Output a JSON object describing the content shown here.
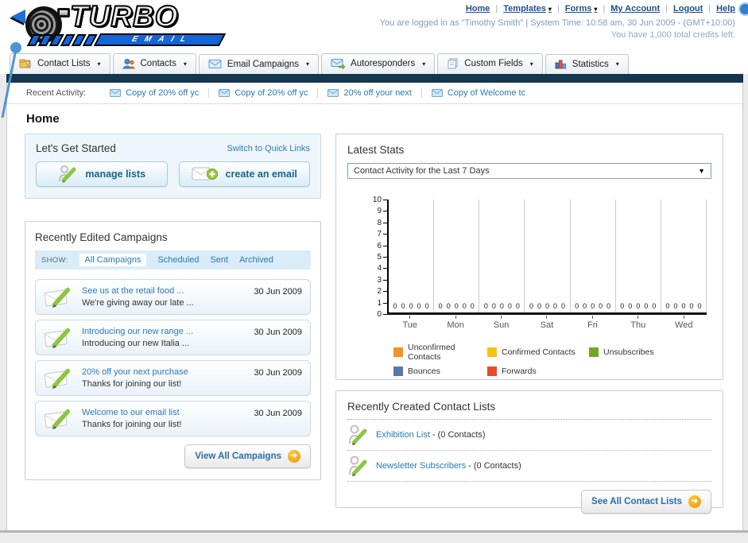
{
  "glyphs": {
    "caret_down": "▼",
    "caret_small": "▼",
    "arrow_right": "➜",
    "separator": "|"
  },
  "colors": {
    "brand_blue": "#1466d8",
    "navy_bar": "#16364e",
    "link_blue": "#2a7ab5",
    "accent_orange": "#ef920b"
  },
  "header": {
    "logo_line1": "TURBO",
    "logo_line2": "EMAIL",
    "nav": {
      "home": "Home",
      "templates": "Templates",
      "forms": "Forms",
      "my_account": "My Account",
      "logout": "Logout",
      "help": "Help"
    },
    "user_line1": "You are logged in as \"Timothy Smith\" | System Time: 10:58 am, 30 Jun 2009 - (GMT+10:00)",
    "user_line2": "You have 1,000 total credits left."
  },
  "tabs": [
    {
      "label": "Contact Lists",
      "icon": "contact-lists-folder-icon"
    },
    {
      "label": "Contacts",
      "icon": "contacts-people-icon"
    },
    {
      "label": "Email Campaigns",
      "icon": "email-envelope-icon"
    },
    {
      "label": "Autoresponders",
      "icon": "autoresponder-envelope-arrow-icon"
    },
    {
      "label": "Custom Fields",
      "icon": "custom-fields-pages-icon"
    },
    {
      "label": "Statistics",
      "icon": "statistics-bars-icon"
    }
  ],
  "recent_activity": {
    "label": "Recent Activity:",
    "items": [
      "Copy of 20% off yc",
      "Copy of 20% off yc",
      "20% off your next",
      "Copy of Welcome tc"
    ]
  },
  "page_title": "Home",
  "get_started": {
    "title": "Let's Get Started",
    "switch_link": "Switch to Quick Links",
    "manage_lists_label": "manage lists",
    "create_email_label": "create an email"
  },
  "campaigns_panel": {
    "title": "Recently Edited Campaigns",
    "show_label": "SHOW:",
    "filters": [
      "All Campaigns",
      "Scheduled",
      "Sent",
      "Archived"
    ],
    "active_filter": "All Campaigns",
    "items": [
      {
        "title": "See us at the retail food ...",
        "subtitle": "We're giving away our late ...",
        "date": "30 Jun 2009"
      },
      {
        "title": "Introducing our new range ...",
        "subtitle": "Introducing our new Italia ...",
        "date": "30 Jun 2009"
      },
      {
        "title": "20% off your next purchase",
        "subtitle": "Thanks for joining our list!",
        "date": "30 Jun 2009"
      },
      {
        "title": "Welcome to our email list",
        "subtitle": "Thanks for joining our list!",
        "date": "30 Jun 2009"
      }
    ],
    "view_all_label": "View All Campaigns"
  },
  "stats_panel": {
    "title": "Latest Stats",
    "dropdown_value": "Contact Activity for the Last 7 Days",
    "legend": [
      {
        "label": "Unconfirmed Contacts",
        "color": "#f6921e"
      },
      {
        "label": "Confirmed Contacts",
        "color": "#fdc013"
      },
      {
        "label": "Unsubscribes",
        "color": "#71a823"
      },
      {
        "label": "Bounces",
        "color": "#5878ac"
      },
      {
        "label": "Forwards",
        "color": "#e74c28"
      }
    ]
  },
  "chart_data": {
    "type": "bar",
    "title": "Contact Activity for the Last 7 Days",
    "categories": [
      "Tue",
      "Mon",
      "Sun",
      "Sat",
      "Fri",
      "Thu",
      "Wed"
    ],
    "series": [
      {
        "name": "Unconfirmed Contacts",
        "color": "#f6921e",
        "values": [
          0,
          0,
          0,
          0,
          0,
          0,
          0
        ]
      },
      {
        "name": "Confirmed Contacts",
        "color": "#fdc013",
        "values": [
          0,
          0,
          0,
          0,
          0,
          0,
          0
        ]
      },
      {
        "name": "Unsubscribes",
        "color": "#71a823",
        "values": [
          0,
          0,
          0,
          0,
          0,
          0,
          0
        ]
      },
      {
        "name": "Bounces",
        "color": "#5878ac",
        "values": [
          0,
          0,
          0,
          0,
          0,
          0,
          0
        ]
      },
      {
        "name": "Forwards",
        "color": "#e74c28",
        "values": [
          0,
          0,
          0,
          0,
          0,
          0,
          0
        ]
      }
    ],
    "xlabel": "",
    "ylabel": "",
    "ylim": [
      0,
      10
    ],
    "yticks": [
      0,
      1,
      2,
      3,
      4,
      5,
      6,
      7,
      8,
      9,
      10
    ],
    "grid": "vertical",
    "legend_position": "bottom",
    "value_labels_shown": true
  },
  "contact_lists_panel": {
    "title": "Recently Created Contact Lists",
    "items": [
      {
        "name": "Exhibition List",
        "suffix": " - (0 Contacts)"
      },
      {
        "name": "Newsletter Subscribers",
        "suffix": " - (0 Contacts)"
      }
    ],
    "see_all_label": "See All Contact Lists"
  }
}
